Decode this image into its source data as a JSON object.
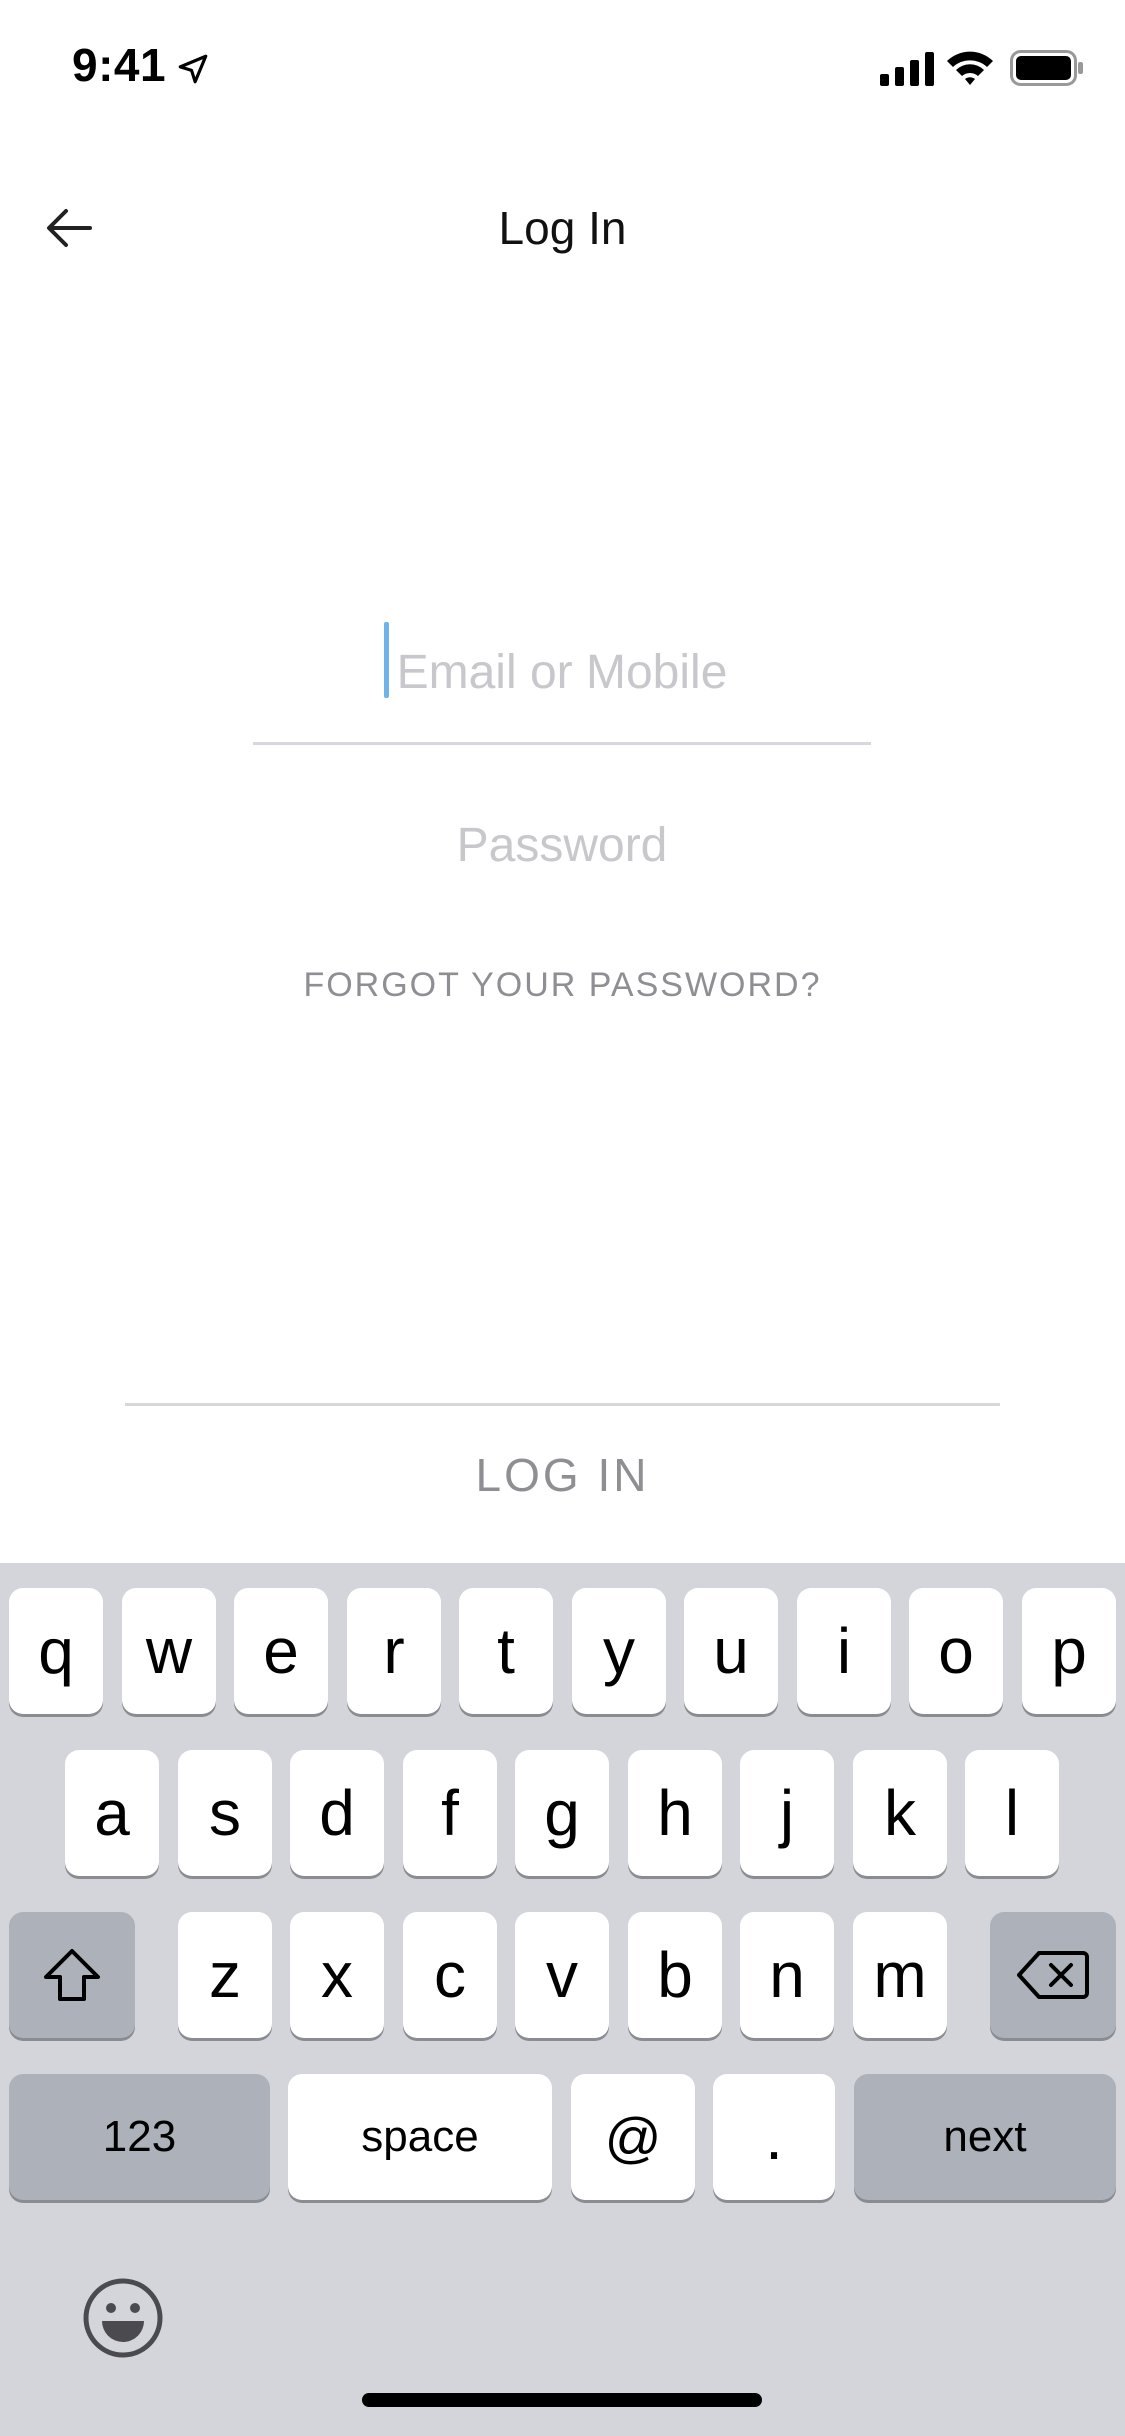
{
  "status_bar": {
    "time": "9:41",
    "icons": [
      "location-arrow-icon",
      "cellular-signal-icon",
      "wifi-icon",
      "battery-icon"
    ]
  },
  "nav": {
    "title": "Log In",
    "back_icon": "arrow-left-icon"
  },
  "form": {
    "email": {
      "placeholder": "Email or Mobile",
      "value": "",
      "focused": true
    },
    "password": {
      "placeholder": "Password",
      "value": ""
    },
    "forgot_password": "FORGOT YOUR PASSWORD?",
    "login_button": "LOG IN"
  },
  "keyboard": {
    "row1": [
      "q",
      "w",
      "e",
      "r",
      "t",
      "y",
      "u",
      "i",
      "o",
      "p"
    ],
    "row2": [
      "a",
      "s",
      "d",
      "f",
      "g",
      "h",
      "j",
      "k",
      "l"
    ],
    "row3": [
      "z",
      "x",
      "c",
      "v",
      "b",
      "n",
      "m"
    ],
    "numbers_key": "123",
    "space_key": "space",
    "at_key": "@",
    "period_key": ".",
    "return_key": "next",
    "shift_icon": "shift-icon",
    "delete_icon": "delete-icon",
    "emoji_icon": "emoji-icon"
  },
  "colors": {
    "caret": "#6fb3e8",
    "placeholder": "#c7c7cc",
    "muted_text": "#8e8e93",
    "keyboard_bg": "#d3d5db",
    "dark_key": "#adb1ba"
  }
}
